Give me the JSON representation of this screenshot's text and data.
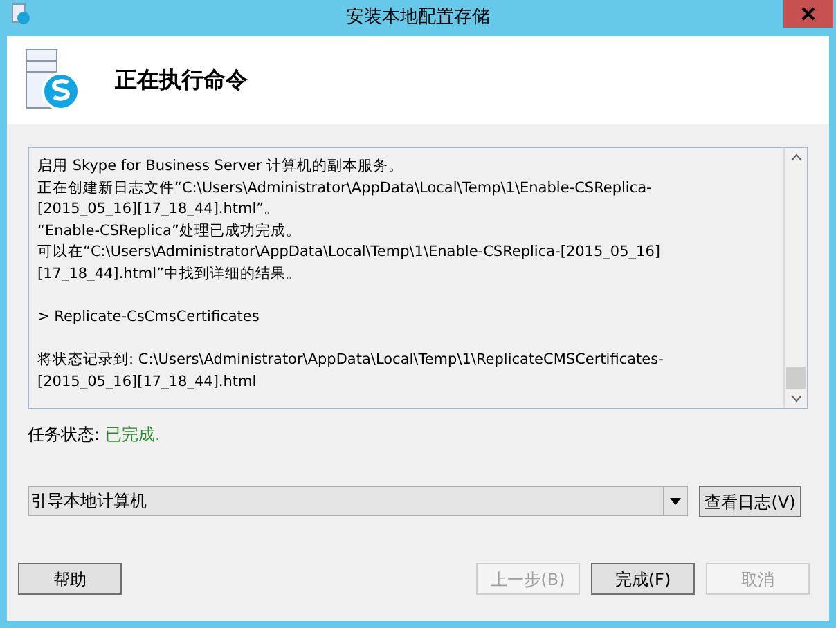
{
  "window": {
    "title": "安装本地配置存储"
  },
  "header": {
    "title": "正在执行命令"
  },
  "log": {
    "blocks": [
      [
        "启用 Skype for Business Server 计算机的副本服务。",
        "正在创建新日志文件“C:\\Users\\Administrator\\AppData\\Local\\Temp\\1\\Enable-CSReplica-",
        "[2015_05_16][17_18_44].html”。",
        "“Enable-CSReplica”处理已成功完成。",
        "可以在“C:\\Users\\Administrator\\AppData\\Local\\Temp\\1\\Enable-CSReplica-[2015_05_16]",
        "[17_18_44].html”中找到详细的结果。"
      ],
      [
        "> Replicate-CsCmsCertificates"
      ],
      [
        "将状态记录到: C:\\Users\\Administrator\\AppData\\Local\\Temp\\1\\ReplicateCMSCertificates-",
        "[2015_05_16][17_18_44].html"
      ]
    ]
  },
  "status": {
    "label": "任务状态:",
    "value": "已完成."
  },
  "action_select": {
    "value": "引导本地计算机"
  },
  "view_log_button": {
    "label": "查看日志(V)",
    "disabled": false
  },
  "buttons": [
    {
      "label": "帮助",
      "disabled": false,
      "kind": "left"
    },
    {
      "label": "上一步(B)",
      "disabled": true,
      "kind": "right"
    },
    {
      "label": "完成(F)",
      "disabled": false,
      "kind": "right"
    },
    {
      "label": "取消",
      "disabled": true,
      "kind": "right"
    }
  ]
}
